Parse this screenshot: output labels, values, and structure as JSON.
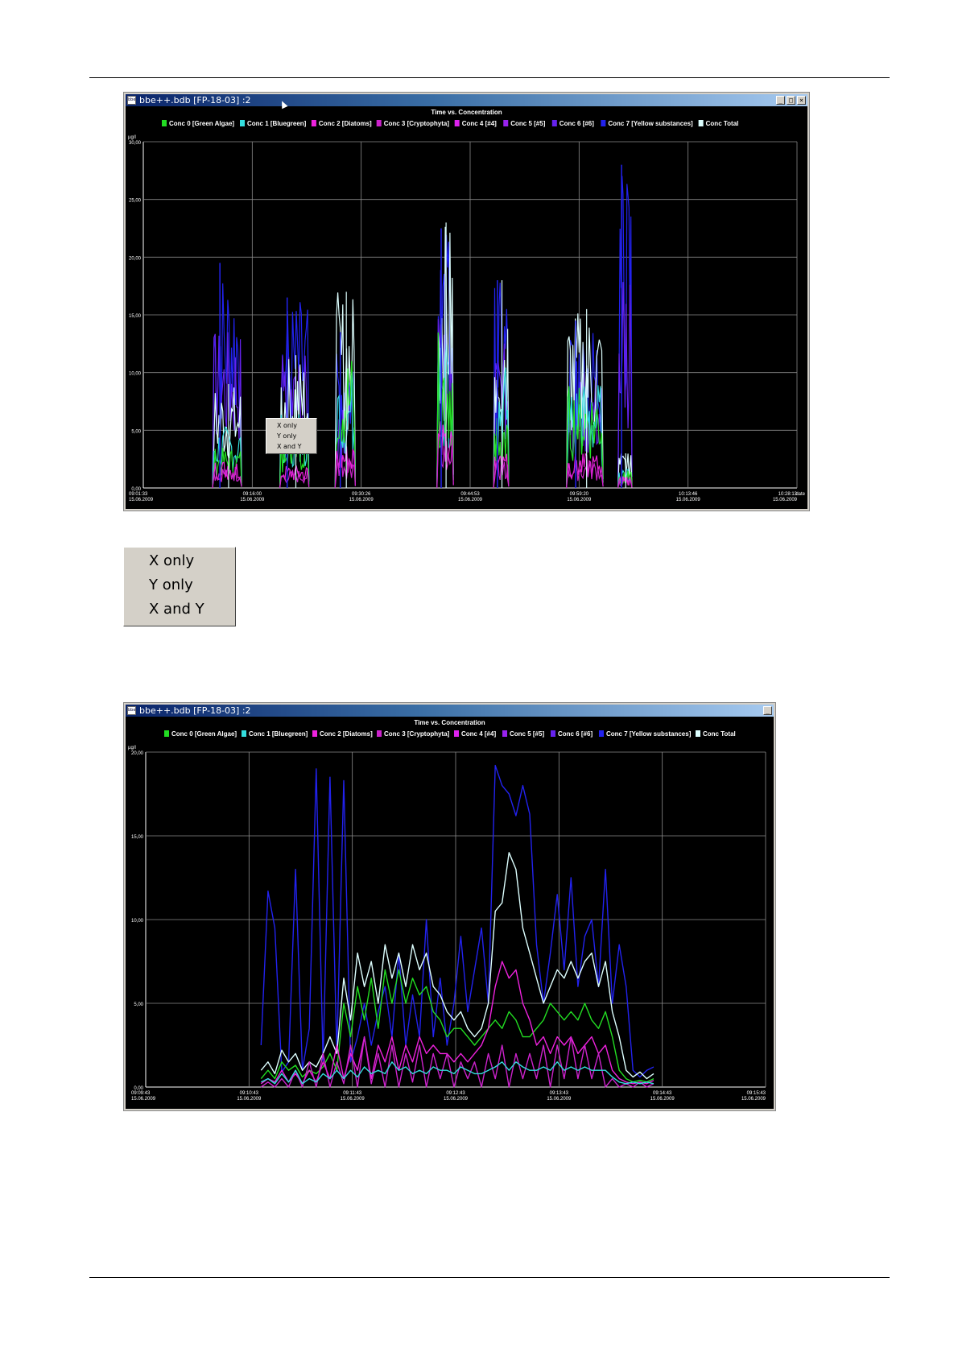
{
  "windows": [
    {
      "title": "bbe++.bdb [FP-18-03] :2",
      "controls": [
        "_",
        "□",
        "×"
      ],
      "menu_overlay": [
        "X only",
        "Y only",
        "X and Y"
      ]
    },
    {
      "title": "bbe++.bdb [FP-18-03] :2",
      "controls": [
        "_"
      ]
    }
  ],
  "zoom_menu": {
    "items": [
      "X only",
      "Y only",
      "X and Y"
    ]
  },
  "legend_entries": [
    {
      "label": "Conc 0 [Green Algae]",
      "color": "#22dd22"
    },
    {
      "label": "Conc 1 [Bluegreen]",
      "color": "#33dddd"
    },
    {
      "label": "Conc 2 [Diatoms]",
      "color": "#ee22dd"
    },
    {
      "label": "Conc 3 [Cryptophyta]",
      "color": "#cc22cc"
    },
    {
      "label": "Conc 4 [#4]",
      "color": "#dd22ee"
    },
    {
      "label": "Conc 5 [#5]",
      "color": "#9922ee"
    },
    {
      "label": "Conc 6 [#6]",
      "color": "#6622ee"
    },
    {
      "label": "Conc 7 [Yellow substances]",
      "color": "#2222ee"
    },
    {
      "label": "Conc Total",
      "color": "#ddffff"
    }
  ],
  "chart_data": [
    {
      "type": "line",
      "title": "Time vs. Concentration",
      "ylabel": "µg/l",
      "xlabel": "date",
      "ylim": [
        0,
        30
      ],
      "yticks": [
        "0,00",
        "5,00",
        "10,00",
        "15,00",
        "20,00",
        "25,00",
        "30,00"
      ],
      "xticks": [
        {
          "time": "09:01:33",
          "date": "15.06.2009"
        },
        {
          "time": "09:16:00",
          "date": "15.06.2009"
        },
        {
          "time": "09:30:26",
          "date": "15.06.2009"
        },
        {
          "time": "09:44:53",
          "date": "15.06.2009"
        },
        {
          "time": "09:59:20",
          "date": "15.06.2009"
        },
        {
          "time": "10:13:46",
          "date": "15.06.2009"
        },
        {
          "time": "10:28:13",
          "date": "15.06.2009"
        }
      ],
      "grid": true,
      "legend": "top",
      "bursts": [
        {
          "start": "09:10:45",
          "end": "09:14:35",
          "peak_conc7": 19.5,
          "peak_total": 9.0,
          "peak_green": 3.5,
          "peak_diatoms": 2.5
        },
        {
          "start": "09:19:40",
          "end": "09:23:30",
          "peak_conc7": 16.5,
          "peak_total": 11.5,
          "peak_green": 5.0,
          "peak_diatoms": 2.0
        },
        {
          "start": "09:27:00",
          "end": "09:29:40",
          "peak_conc7": 13.5,
          "peak_total": 17.0,
          "peak_green": 12.0,
          "peak_diatoms": 4.0
        },
        {
          "start": "09:40:30",
          "end": "09:42:40",
          "peak_conc7": 22.5,
          "peak_total": 23.0,
          "peak_green": 13.5,
          "peak_diatoms": 6.0
        },
        {
          "start": "09:48:00",
          "end": "09:50:00",
          "peak_conc7": 18.0,
          "peak_total": 18.0,
          "peak_green": 6.5,
          "peak_diatoms": 3.0
        },
        {
          "start": "09:57:40",
          "end": "10:02:30",
          "peak_conc7": 14.5,
          "peak_total": 15.5,
          "peak_green": 9.0,
          "peak_diatoms": 3.0
        },
        {
          "start": "10:04:30",
          "end": "10:06:20",
          "peak_conc7": 28.0,
          "peak_total": 3.0,
          "peak_green": 1.5,
          "peak_diatoms": 1.0
        }
      ]
    },
    {
      "type": "line",
      "title": "Time vs. Concentration",
      "ylabel": "µg/l",
      "ylim": [
        0,
        20
      ],
      "yticks": [
        "0,00",
        "5,00",
        "10,00",
        "15,00",
        "20,00"
      ],
      "xticks": [
        {
          "time": "09:09:43",
          "date": "15.06.2009"
        },
        {
          "time": "09:10:43",
          "date": "15.06.2009"
        },
        {
          "time": "09:11:43",
          "date": "15.06.2009"
        },
        {
          "time": "09:12:43",
          "date": "15.06.2009"
        },
        {
          "time": "09:13:43",
          "date": "15.06.2009"
        },
        {
          "time": "09:14:43",
          "date": "15.06.2009"
        },
        {
          "time": "09:15:43",
          "date": "15.06.2009"
        }
      ],
      "grid": true,
      "legend": "top",
      "series": [
        {
          "name": "Conc 7 [Yellow substances]",
          "start_time": "09:10:50",
          "step_seconds": 4,
          "values": [
            2.5,
            11.7,
            9.5,
            0.9,
            1.5,
            13.0,
            1.0,
            3.5,
            19.0,
            1.5,
            18.5,
            2.0,
            18.3,
            1.5,
            3.0,
            5.0,
            2.5,
            4.5,
            6.0,
            3.0,
            8.0,
            2.5,
            5.5,
            3.0,
            10.0,
            3.0,
            6.5,
            2.5,
            5.0,
            9.0,
            4.5,
            7.0,
            9.5,
            5.0,
            19.2,
            18.0,
            17.5,
            16.2,
            18.0,
            16.3,
            8.5,
            5.0,
            8.0,
            11.5,
            7.0,
            12.5,
            6.0,
            9.0,
            10.0,
            6.0,
            13.0,
            5.0,
            8.5,
            6.0,
            1.0,
            0.6,
            1.0,
            1.2
          ]
        },
        {
          "name": "Conc Total",
          "start_time": "09:10:50",
          "step_seconds": 4,
          "values": [
            1.0,
            1.5,
            0.8,
            2.2,
            1.5,
            2.0,
            1.0,
            1.5,
            1.2,
            2.0,
            3.0,
            2.0,
            6.5,
            4.0,
            8.0,
            6.0,
            7.5,
            5.0,
            8.5,
            6.5,
            8.0,
            6.0,
            8.5,
            7.0,
            8.0,
            6.0,
            5.5,
            4.5,
            4.0,
            4.5,
            3.5,
            3.0,
            3.5,
            5.0,
            10.5,
            11.0,
            14.0,
            13.0,
            9.5,
            8.0,
            6.5,
            5.0,
            6.0,
            7.0,
            6.5,
            7.5,
            6.5,
            7.5,
            8.0,
            6.0,
            7.5,
            4.5,
            3.0,
            1.0,
            0.6,
            0.9,
            0.5,
            0.8
          ]
        },
        {
          "name": "Conc 0 [Green Algae]",
          "start_time": "09:10:50",
          "step_seconds": 4,
          "values": [
            0.5,
            1.0,
            0.5,
            1.5,
            1.0,
            1.3,
            0.6,
            1.0,
            0.8,
            1.2,
            2.0,
            1.0,
            5.0,
            3.0,
            6.0,
            4.0,
            6.5,
            3.5,
            7.0,
            5.0,
            7.0,
            5.0,
            6.5,
            5.5,
            6.0,
            4.5,
            4.0,
            3.0,
            3.5,
            3.5,
            3.0,
            2.5,
            3.0,
            3.5,
            4.0,
            3.5,
            4.5,
            4.0,
            3.0,
            3.0,
            3.5,
            4.0,
            5.0,
            4.5,
            4.0,
            4.5,
            4.0,
            5.0,
            4.0,
            3.5,
            4.5,
            3.0,
            1.0,
            0.5,
            0.3,
            0.4,
            0.3,
            0.5
          ]
        },
        {
          "name": "Conc 2 [Diatoms]",
          "start_time": "09:10:50",
          "step_seconds": 4,
          "values": [
            0.2,
            0.5,
            0.3,
            1.0,
            0.3,
            0.8,
            0.2,
            1.0,
            0.3,
            1.5,
            0.5,
            2.5,
            0.5,
            2.0,
            1.0,
            3.0,
            0.5,
            2.5,
            1.5,
            3.0,
            1.0,
            2.5,
            1.5,
            3.0,
            2.0,
            2.5,
            2.0,
            2.0,
            1.5,
            2.0,
            1.5,
            2.0,
            2.5,
            3.5,
            6.0,
            7.5,
            6.5,
            7.0,
            5.0,
            4.0,
            2.5,
            3.0,
            2.0,
            3.0,
            2.5,
            3.0,
            2.0,
            2.5,
            3.0,
            2.0,
            2.5,
            1.0,
            0.5,
            0.3,
            0.2,
            0.3,
            0.2,
            0.4
          ]
        },
        {
          "name": "Conc 3 [Cryptophyta]",
          "start_time": "09:10:50",
          "step_seconds": 4,
          "values": [
            0.0,
            0.3,
            0.0,
            0.5,
            0.0,
            1.0,
            0.0,
            1.5,
            0.0,
            2.0,
            0.0,
            1.5,
            0.2,
            2.5,
            0.0,
            3.0,
            0.2,
            2.0,
            0.0,
            2.5,
            0.0,
            2.0,
            0.3,
            2.5,
            0.0,
            2.0,
            0.5,
            2.0,
            0.0,
            1.5,
            0.5,
            1.5,
            0.0,
            2.0,
            0.5,
            2.5,
            0.0,
            2.0,
            0.5,
            2.0,
            0.5,
            2.5,
            0.0,
            2.5,
            0.5,
            3.0,
            0.5,
            2.5,
            0.5,
            2.0,
            0.0,
            0.5,
            0.0,
            0.2,
            0.0,
            0.3,
            0.0,
            0.2
          ]
        },
        {
          "name": "Conc 1 [Bluegreen]",
          "start_time": "09:10:50",
          "step_seconds": 4,
          "values": [
            0.3,
            0.5,
            0.2,
            0.8,
            0.3,
            1.0,
            0.2,
            0.5,
            0.3,
            0.8,
            0.5,
            1.0,
            0.5,
            1.0,
            0.6,
            1.2,
            0.8,
            1.0,
            0.8,
            1.5,
            1.0,
            1.2,
            0.8,
            1.0,
            0.8,
            1.2,
            1.0,
            1.0,
            0.8,
            1.2,
            1.0,
            0.8,
            0.8,
            1.0,
            1.2,
            1.5,
            1.0,
            1.5,
            1.2,
            1.0,
            1.0,
            1.2,
            1.0,
            1.5,
            1.0,
            1.2,
            1.0,
            1.2,
            1.0,
            1.0,
            1.0,
            0.6,
            0.3,
            0.2,
            0.3,
            0.2,
            0.3,
            0.2
          ]
        }
      ]
    }
  ]
}
